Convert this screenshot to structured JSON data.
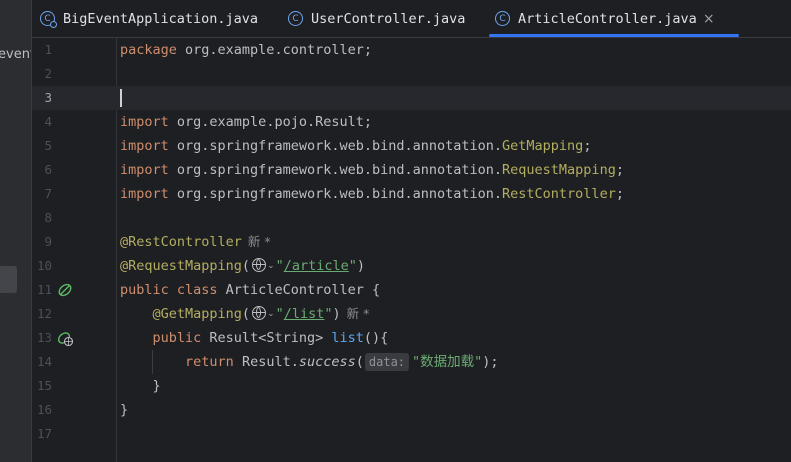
{
  "sidebar": {
    "project_label": "event"
  },
  "tabs": [
    {
      "label": "BigEventApplication.java",
      "icon": "app-class-icon",
      "active": false
    },
    {
      "label": "UserController.java",
      "icon": "class-icon",
      "active": false
    },
    {
      "label": "ArticleController.java",
      "icon": "class-icon",
      "active": true
    }
  ],
  "tab_close_glyph": "×",
  "class_icon_glyph": "C",
  "line_numbers": [
    "1",
    "2",
    "3",
    "4",
    "5",
    "6",
    "7",
    "8",
    "9",
    "10",
    "11",
    "12",
    "13",
    "14",
    "15",
    "16",
    "17"
  ],
  "code": {
    "l1_kw": "package",
    "l1_rest": " org.example.controller;",
    "l4_kw": "import",
    "l4_rest": " org.example.pojo.Result;",
    "l5_kw": "import",
    "l5_rest": " org.springframework.web.bind.annotation.",
    "l5_ann": "GetMapping",
    "l5_end": ";",
    "l6_kw": "import",
    "l6_rest": " org.springframework.web.bind.annotation.",
    "l6_ann": "RequestMapping",
    "l6_end": ";",
    "l7_kw": "import",
    "l7_rest": " org.springframework.web.bind.annotation.",
    "l7_ann": "RestController",
    "l7_end": ";",
    "l9_ann": "@RestController",
    "l9_hint": "新 *",
    "l10_ann": "@RequestMapping",
    "l10_open": "(",
    "l10_q1": "\"",
    "l10_url": "/article",
    "l10_q2": "\"",
    "l10_close": ")",
    "l11_kw": "public class",
    "l11_rest": " ArticleController {",
    "l12_indent": "    ",
    "l12_ann": "@GetMapping",
    "l12_open": "(",
    "l12_q1": "\"",
    "l12_url": "/list",
    "l12_q2": "\"",
    "l12_close": ")",
    "l12_hint": "新 *",
    "l13_indent": "    ",
    "l13_kw": "public",
    "l13_rest": " Result<String> ",
    "l13_fn": "list",
    "l13_end": "(){",
    "l14_indent": "        ",
    "l14_kw": "return",
    "l14_rest": " Result.",
    "l14_fn": "success",
    "l14_open": "(",
    "l14_param": "data:",
    "l14_str": "\"数据加载\"",
    "l14_end": ");",
    "l15_text": "    }",
    "l16_text": "}"
  },
  "colors": {
    "keyword": "#cf8e6d",
    "annotation": "#b3ae60",
    "string": "#6aab73",
    "function": "#56a8f5",
    "accent": "#3574f0"
  }
}
